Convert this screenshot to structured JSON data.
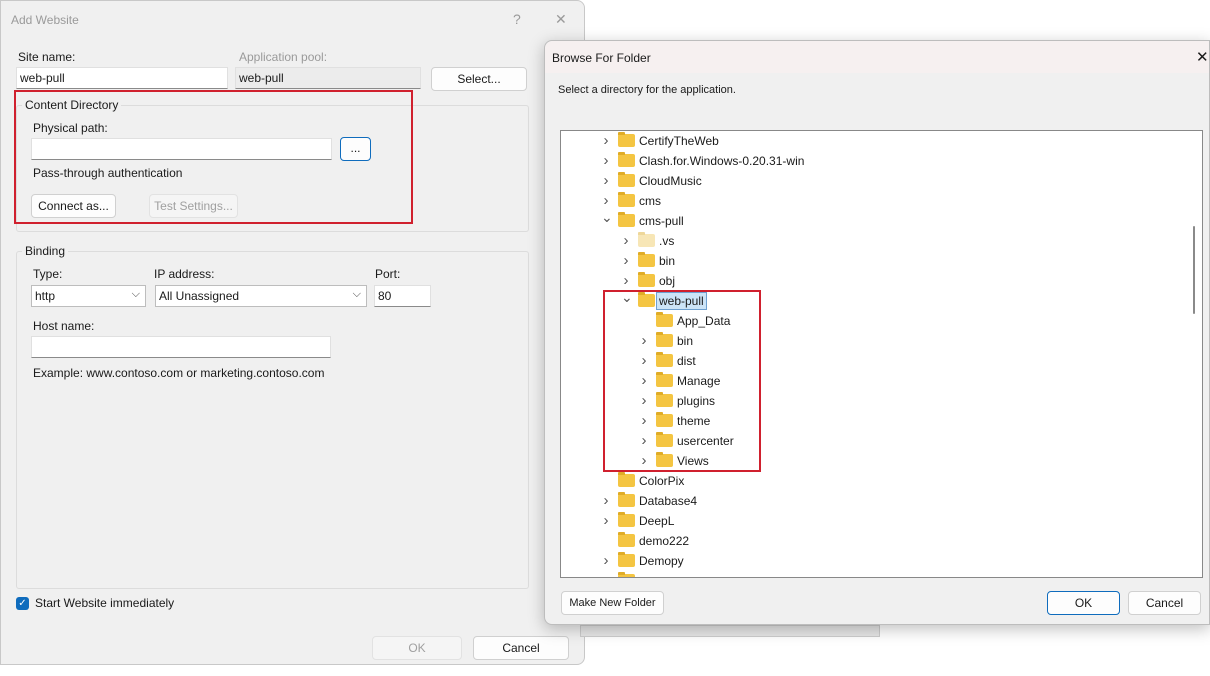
{
  "add_website": {
    "title": "Add Website",
    "help": "?",
    "close": "✕",
    "site_name_label": "Site name:",
    "site_name": "web-pull",
    "app_pool_label": "Application pool:",
    "app_pool": "web-pull",
    "select_label": "Select...",
    "content_directory": "Content Directory",
    "physical_path_label": "Physical path:",
    "physical_path": "",
    "browse_label": "...",
    "pass_through": "Pass-through authentication",
    "connect_as": "Connect as...",
    "test_settings": "Test Settings...",
    "binding": "Binding",
    "type_label": "Type:",
    "type_value": "http",
    "ip_label": "IP address:",
    "ip_value": "All Unassigned",
    "port_label": "Port:",
    "port_value": "80",
    "host_label": "Host name:",
    "host_value": "",
    "example": "Example: www.contoso.com or marketing.contoso.com",
    "start_immediately": "Start Website immediately",
    "start_checked": true,
    "ok": "OK",
    "cancel": "Cancel"
  },
  "browse": {
    "title": "Browse For Folder",
    "close": "✕",
    "instruction": "Select a directory for the application.",
    "make_new_folder": "Make New Folder",
    "ok": "OK",
    "cancel": "Cancel",
    "tree": [
      {
        "label": "CertifyTheWeb",
        "level": 0,
        "expander": "collapsed"
      },
      {
        "label": "Clash.for.Windows-0.20.31-win",
        "level": 0,
        "expander": "collapsed"
      },
      {
        "label": "CloudMusic",
        "level": 0,
        "expander": "collapsed"
      },
      {
        "label": "cms",
        "level": 0,
        "expander": "collapsed"
      },
      {
        "label": "cms-pull",
        "level": 0,
        "expander": "expanded"
      },
      {
        "label": ".vs",
        "level": 1,
        "expander": "collapsed",
        "hidden": true
      },
      {
        "label": "bin",
        "level": 1,
        "expander": "collapsed"
      },
      {
        "label": "obj",
        "level": 1,
        "expander": "collapsed"
      },
      {
        "label": "web-pull",
        "level": 1,
        "expander": "expanded",
        "selected": true
      },
      {
        "label": "App_Data",
        "level": 2,
        "expander": "none"
      },
      {
        "label": "bin",
        "level": 2,
        "expander": "collapsed"
      },
      {
        "label": "dist",
        "level": 2,
        "expander": "collapsed"
      },
      {
        "label": "Manage",
        "level": 2,
        "expander": "collapsed"
      },
      {
        "label": "plugins",
        "level": 2,
        "expander": "collapsed"
      },
      {
        "label": "theme",
        "level": 2,
        "expander": "collapsed"
      },
      {
        "label": "usercenter",
        "level": 2,
        "expander": "collapsed"
      },
      {
        "label": "Views",
        "level": 2,
        "expander": "collapsed"
      },
      {
        "label": "ColorPix",
        "level": 0,
        "expander": "none"
      },
      {
        "label": "Database4",
        "level": 0,
        "expander": "collapsed"
      },
      {
        "label": "DeepL",
        "level": 0,
        "expander": "collapsed"
      },
      {
        "label": "demo222",
        "level": 0,
        "expander": "none"
      },
      {
        "label": "Demopy",
        "level": 0,
        "expander": "collapsed"
      },
      {
        "label": "",
        "level": 0,
        "expander": "none"
      }
    ]
  },
  "colors": {
    "highlight": "#d0202e",
    "accent": "#0f6cbd",
    "folder": "#f4c542"
  }
}
